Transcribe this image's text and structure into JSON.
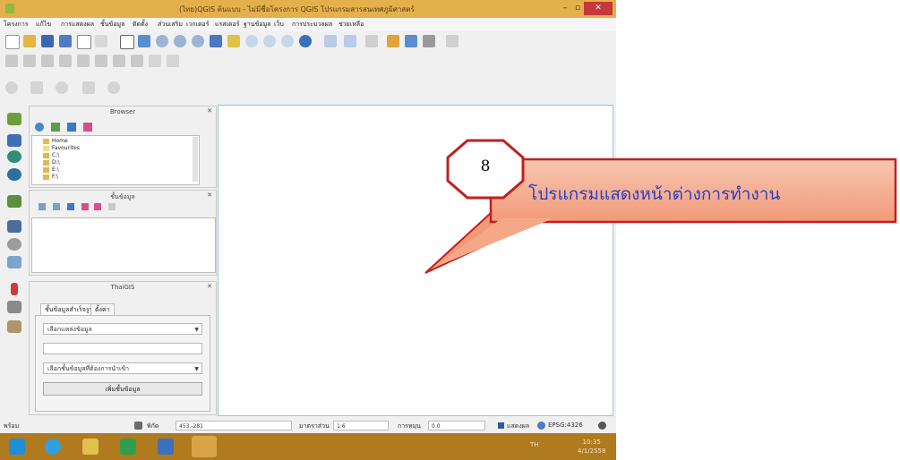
{
  "window": {
    "title": "(ไทย)QGIS ต้นแบบ - ไม่มีชื่อโครงการ QGIS โปรแกรมสารสนเทศภูมิศาสตร์",
    "minimize_label": "–",
    "maximize_label": "▫",
    "close_label": "✕"
  },
  "menubar": {
    "items": [
      "โครงการ",
      "แก้ไข",
      "การแสดงผล",
      "ชั้นข้อมูล",
      "ติดตั้ง",
      "ส่วนเสริม",
      "เวกเตอร์",
      "แรสเตอร์",
      "ฐานข้อมูล",
      "เว็บ",
      "การประมวลผล",
      "ช่วยเหลือ"
    ]
  },
  "browser_panel": {
    "title": "Browser",
    "close_label": "✕",
    "tree": [
      "Home",
      "Favourites",
      "C:\\",
      "D:\\",
      "E:\\",
      "F:\\"
    ]
  },
  "layers_panel": {
    "title": "ชั้นข้อมูล",
    "close_label": "✕"
  },
  "thaigis_panel": {
    "title": "ThaiGIS",
    "close_label": "✕",
    "tabs": [
      "ชั้นข้อมูลสำเร็จรูป",
      "ตั้งค่า"
    ],
    "combo_source": "เลือกแหล่งข้อมูล",
    "input_value": "",
    "combo_layer": "เลือกชั้นข้อมูลที่ต้องการนำเข้า",
    "add_button": "เพิ่มชั้นข้อมูล"
  },
  "statusbar": {
    "ready_label": "พร้อม",
    "coord_label": "พิกัด",
    "coord_value": "453,-281",
    "scale_label": "มาตราส่วน",
    "scale_value": "1:6",
    "rotation_label": "การหมุน",
    "rotation_value": "0.0",
    "render_label": "แสดงผล",
    "crs_label": "EPSG:4326"
  },
  "taskbar": {
    "tray_text": "TH",
    "time": "10:35",
    "date": "4/1/2558"
  },
  "callout": {
    "number": "8",
    "label": "โปรแกรมแสดงหน้าต่างการทำงาน"
  },
  "colors": {
    "title_bar": "#e3b04b",
    "taskbar": "#b07a1e",
    "callout_fill": "#f6b59a",
    "callout_border": "#c21f1f",
    "callout_text": "#2a3fc8"
  }
}
